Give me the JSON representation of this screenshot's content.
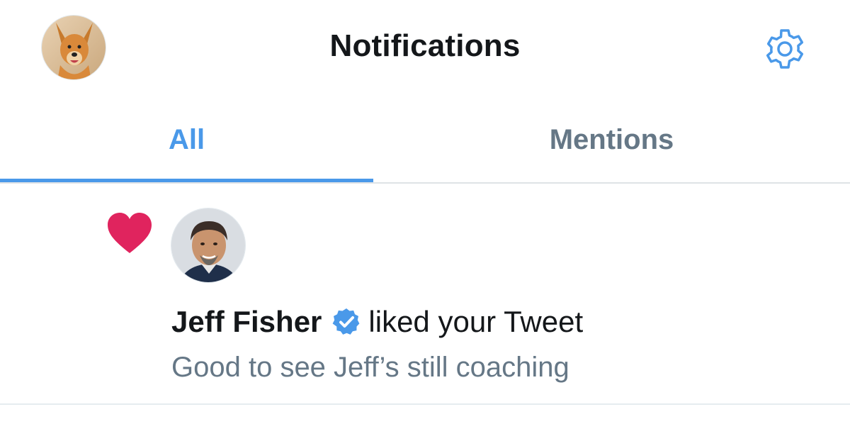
{
  "header": {
    "title": "Notifications",
    "avatar_icon": "user-avatar-dog",
    "settings_icon": "gear-icon"
  },
  "tabs": [
    {
      "label": "All",
      "selected": true
    },
    {
      "label": "Mentions",
      "selected": false
    }
  ],
  "notification": {
    "type_icon": "heart-icon",
    "user_name": "Jeff Fisher",
    "verified": true,
    "action": "liked your Tweet",
    "tweet_text": "Good to see Jeff’s still coaching"
  },
  "colors": {
    "accent": "#4a99e9",
    "heart": "#e0245e",
    "secondary_text": "#657786",
    "primary_text": "#14171a"
  }
}
